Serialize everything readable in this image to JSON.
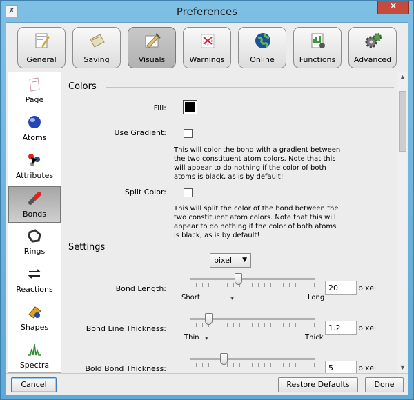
{
  "window": {
    "title": "Preferences",
    "close_glyph": "✕",
    "app_icon": "app-icon"
  },
  "tabs": [
    {
      "label": "General",
      "icon": "general-icon"
    },
    {
      "label": "Saving",
      "icon": "saving-icon"
    },
    {
      "label": "Visuals",
      "icon": "visuals-icon",
      "active": true
    },
    {
      "label": "Warnings",
      "icon": "warnings-icon"
    },
    {
      "label": "Online",
      "icon": "globe-icon"
    },
    {
      "label": "Functions",
      "icon": "functions-icon"
    },
    {
      "label": "Advanced",
      "icon": "gears-icon"
    }
  ],
  "sidebar": {
    "items": [
      {
        "label": "Page",
        "icon": "page-icon"
      },
      {
        "label": "Atoms",
        "icon": "atom-icon"
      },
      {
        "label": "Attributes",
        "icon": "attributes-icon"
      },
      {
        "label": "Bonds",
        "icon": "bond-icon",
        "active": true
      },
      {
        "label": "Rings",
        "icon": "rings-icon"
      },
      {
        "label": "Reactions",
        "icon": "reactions-icon"
      },
      {
        "label": "Shapes",
        "icon": "shapes-icon"
      },
      {
        "label": "Spectra",
        "icon": "spectra-icon"
      }
    ]
  },
  "colors": {
    "section_title": "Colors",
    "fill_label": "Fill:",
    "fill_color": "#000000",
    "gradient_label": "Use Gradient:",
    "gradient_checked": false,
    "gradient_desc": "This will color the bond with a gradient between the two constituent atom colors. Note that this will appear to do nothing if the color of both atoms is black, as is by default!",
    "split_label": "Split Color:",
    "split_checked": false,
    "split_desc": "This will split the color of the bond between the two constituent atom colors. Note that this will appear to do nothing if the color of both atoms is black, as is by default!"
  },
  "settings": {
    "section_title": "Settings",
    "unit_select": "pixel",
    "bond_length": {
      "label": "Bond Length:",
      "value": "20",
      "unit": "pixel",
      "min_label": "Short",
      "max_label": "Long",
      "default_mark": "*",
      "level": 0.38
    },
    "line_thickness": {
      "label": "Bond Line Thickness:",
      "value": "1.2",
      "unit": "pixel",
      "min_label": "Thin",
      "max_label": "Thick",
      "default_mark": "*",
      "level": 0.13
    },
    "bold_thickness": {
      "label": "Bold Bond Thickness:",
      "value": "5",
      "unit": "pixel",
      "level": 0.26
    }
  },
  "buttons": {
    "cancel": "Cancel",
    "restore": "Restore Defaults",
    "done": "Done"
  }
}
